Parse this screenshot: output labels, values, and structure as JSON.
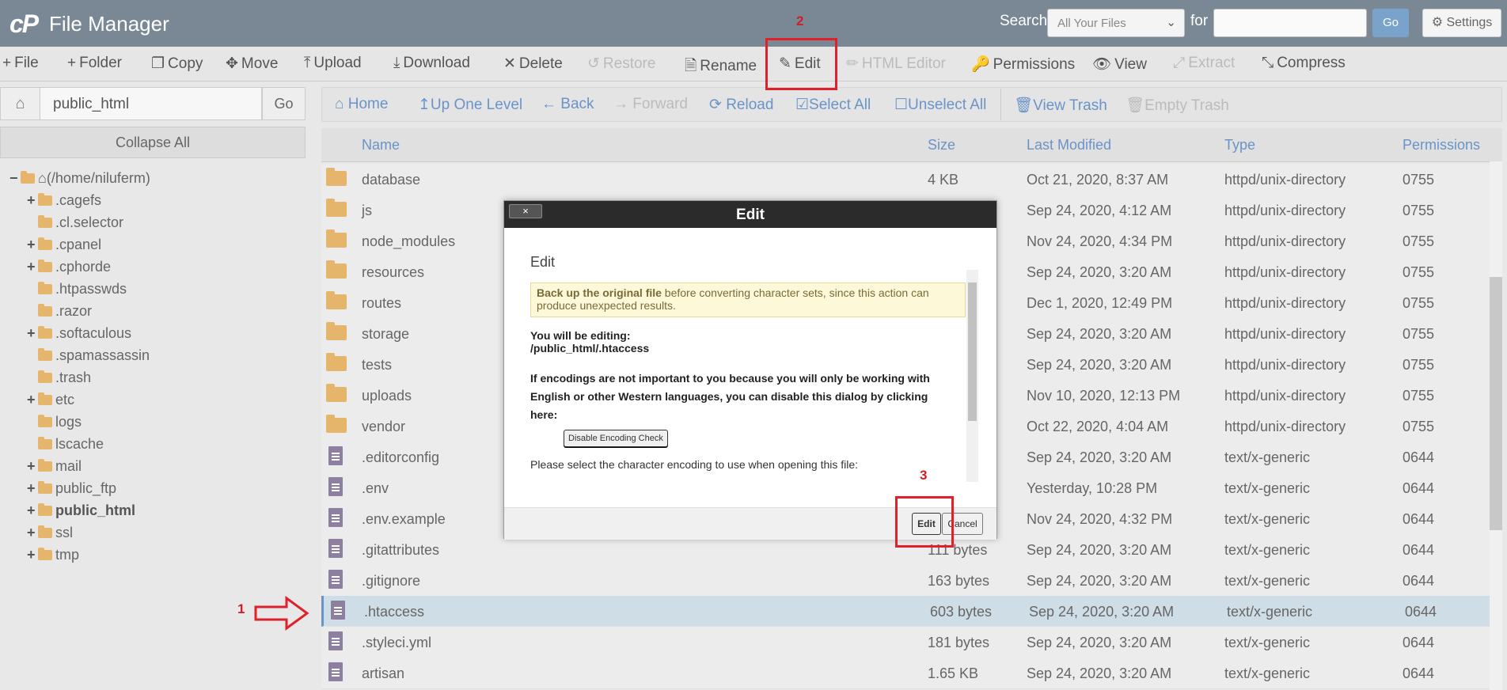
{
  "header": {
    "logo": "cP",
    "title": "File Manager",
    "search_label": "Search",
    "search_scope": "All Your Files",
    "for_label": "for",
    "search_value": "",
    "go_label": "Go",
    "settings_label": "Settings"
  },
  "toolbar": {
    "items": [
      {
        "label": "File",
        "icon": "plus-icon",
        "enabled": true
      },
      {
        "label": "Folder",
        "icon": "plus-icon",
        "enabled": true
      },
      {
        "label": "Copy",
        "icon": "copy-icon",
        "enabled": true
      },
      {
        "label": "Move",
        "icon": "move-icon",
        "enabled": true
      },
      {
        "label": "Upload",
        "icon": "upload-icon",
        "enabled": true
      },
      {
        "label": "Download",
        "icon": "download-icon",
        "enabled": true
      },
      {
        "label": "Delete",
        "icon": "close-icon",
        "enabled": true
      },
      {
        "label": "Restore",
        "icon": "undo-icon",
        "enabled": false
      },
      {
        "label": "Rename",
        "icon": "file-icon",
        "enabled": true
      },
      {
        "label": "Edit",
        "icon": "pencil-icon",
        "enabled": true
      },
      {
        "label": "HTML Editor",
        "icon": "edit-icon",
        "enabled": false
      },
      {
        "label": "Permissions",
        "icon": "key-icon",
        "enabled": true
      },
      {
        "label": "View",
        "icon": "eye-icon",
        "enabled": true
      },
      {
        "label": "Extract",
        "icon": "expand-icon",
        "enabled": false
      },
      {
        "label": "Compress",
        "icon": "compress-icon",
        "enabled": true
      }
    ]
  },
  "pathbar": {
    "path": "public_html",
    "go_label": "Go",
    "collapse_label": "Collapse All"
  },
  "tree": {
    "root": "(/home/niluferm)",
    "items": [
      {
        "label": ".cagefs",
        "expandable": true,
        "bold": false
      },
      {
        "label": ".cl.selector",
        "expandable": false,
        "bold": false
      },
      {
        "label": ".cpanel",
        "expandable": true,
        "bold": false
      },
      {
        "label": ".cphorde",
        "expandable": true,
        "bold": false
      },
      {
        "label": ".htpasswds",
        "expandable": false,
        "bold": false
      },
      {
        "label": ".razor",
        "expandable": false,
        "bold": false
      },
      {
        "label": ".softaculous",
        "expandable": true,
        "bold": false
      },
      {
        "label": ".spamassassin",
        "expandable": false,
        "bold": false
      },
      {
        "label": ".trash",
        "expandable": false,
        "bold": false
      },
      {
        "label": "etc",
        "expandable": true,
        "bold": false
      },
      {
        "label": "logs",
        "expandable": false,
        "bold": false
      },
      {
        "label": "lscache",
        "expandable": false,
        "bold": false
      },
      {
        "label": "mail",
        "expandable": true,
        "bold": false
      },
      {
        "label": "public_ftp",
        "expandable": true,
        "bold": false
      },
      {
        "label": "public_html",
        "expandable": true,
        "bold": true
      },
      {
        "label": "ssl",
        "expandable": true,
        "bold": false
      },
      {
        "label": "tmp",
        "expandable": true,
        "bold": false
      }
    ]
  },
  "nav": {
    "items": [
      {
        "label": "Home",
        "icon": "home-icon",
        "enabled": true
      },
      {
        "label": "Up One Level",
        "icon": "arrow-up-icon",
        "enabled": true
      },
      {
        "label": "Back",
        "icon": "arrow-left-icon",
        "enabled": true
      },
      {
        "label": "Forward",
        "icon": "arrow-right-icon",
        "enabled": false
      },
      {
        "label": "Reload",
        "icon": "reload-icon",
        "enabled": true
      },
      {
        "label": "Select All",
        "icon": "checkbox-checked-icon",
        "enabled": true
      },
      {
        "label": "Unselect All",
        "icon": "checkbox-empty-icon",
        "enabled": true
      },
      {
        "label": "View Trash",
        "icon": "trash-icon",
        "enabled": true
      },
      {
        "label": "Empty Trash",
        "icon": "trash-icon",
        "enabled": false
      }
    ]
  },
  "table": {
    "columns": [
      "Name",
      "Size",
      "Last Modified",
      "Type",
      "Permissions"
    ],
    "rows": [
      {
        "name": "database",
        "kind": "folder",
        "size": "4 KB",
        "modified": "Oct 21, 2020, 8:37 AM",
        "type": "httpd/unix-directory",
        "perms": "0755",
        "selected": false
      },
      {
        "name": "js",
        "kind": "folder",
        "size": "",
        "modified": "Sep 24, 2020, 4:12 AM",
        "type": "httpd/unix-directory",
        "perms": "0755",
        "selected": false
      },
      {
        "name": "node_modules",
        "kind": "folder",
        "size": "",
        "modified": "Nov 24, 2020, 4:34 PM",
        "type": "httpd/unix-directory",
        "perms": "0755",
        "selected": false
      },
      {
        "name": "resources",
        "kind": "folder",
        "size": "",
        "modified": "Sep 24, 2020, 3:20 AM",
        "type": "httpd/unix-directory",
        "perms": "0755",
        "selected": false
      },
      {
        "name": "routes",
        "kind": "folder",
        "size": "",
        "modified": "Dec 1, 2020, 12:49 PM",
        "type": "httpd/unix-directory",
        "perms": "0755",
        "selected": false
      },
      {
        "name": "storage",
        "kind": "folder",
        "size": "",
        "modified": "Sep 24, 2020, 3:20 AM",
        "type": "httpd/unix-directory",
        "perms": "0755",
        "selected": false
      },
      {
        "name": "tests",
        "kind": "folder",
        "size": "",
        "modified": "Sep 24, 2020, 3:20 AM",
        "type": "httpd/unix-directory",
        "perms": "0755",
        "selected": false
      },
      {
        "name": "uploads",
        "kind": "folder",
        "size": "",
        "modified": "Nov 10, 2020, 12:13 PM",
        "type": "httpd/unix-directory",
        "perms": "0755",
        "selected": false
      },
      {
        "name": "vendor",
        "kind": "folder",
        "size": "",
        "modified": "Oct 22, 2020, 4:04 AM",
        "type": "httpd/unix-directory",
        "perms": "0755",
        "selected": false
      },
      {
        "name": ".editorconfig",
        "kind": "file",
        "size": "",
        "modified": "Sep 24, 2020, 3:20 AM",
        "type": "text/x-generic",
        "perms": "0644",
        "selected": false
      },
      {
        "name": ".env",
        "kind": "file",
        "size": "",
        "modified": "Yesterday, 10:28 PM",
        "type": "text/x-generic",
        "perms": "0644",
        "selected": false
      },
      {
        "name": ".env.example",
        "kind": "file",
        "size": "",
        "modified": "Nov 24, 2020, 4:32 PM",
        "type": "text/x-generic",
        "perms": "0644",
        "selected": false
      },
      {
        "name": ".gitattributes",
        "kind": "file",
        "size": "111 bytes",
        "modified": "Sep 24, 2020, 3:20 AM",
        "type": "text/x-generic",
        "perms": "0644",
        "selected": false
      },
      {
        "name": ".gitignore",
        "kind": "file",
        "size": "163 bytes",
        "modified": "Sep 24, 2020, 3:20 AM",
        "type": "text/x-generic",
        "perms": "0644",
        "selected": false
      },
      {
        "name": ".htaccess",
        "kind": "file",
        "size": "603 bytes",
        "modified": "Sep 24, 2020, 3:20 AM",
        "type": "text/x-generic",
        "perms": "0644",
        "selected": true
      },
      {
        "name": ".styleci.yml",
        "kind": "file",
        "size": "181 bytes",
        "modified": "Sep 24, 2020, 3:20 AM",
        "type": "text/x-generic",
        "perms": "0644",
        "selected": false
      },
      {
        "name": "artisan",
        "kind": "file",
        "size": "1.65 KB",
        "modified": "Sep 24, 2020, 3:20 AM",
        "type": "text/x-generic",
        "perms": "0644",
        "selected": false
      }
    ]
  },
  "annotations": {
    "step1": "1",
    "step2": "2",
    "step3": "3",
    "color": "#e0202a"
  },
  "modal": {
    "title": "Edit",
    "close_label": "×",
    "heading": "Edit",
    "warning_bold": "Back up the original file",
    "warning_rest": " before converting character sets, since this action can produce unexpected results.",
    "editing_label": "You will be editing:",
    "editing_path": "/public_html/.htaccess",
    "encoding_text": "If encodings are not important to you because you will only be working with English or other Western languages, you can disable this dialog by clicking here:",
    "disable_button": "Disable Encoding Check",
    "select_text": "Please select the character encoding to use when opening this file:",
    "edit_button": "Edit",
    "cancel_button": "Cancel"
  },
  "colors": {
    "topbar": "#7a8794",
    "link": "#6a94c8",
    "folder": "#e6b56c",
    "file": "#8c7fa0",
    "selected_row": "#cfdde6"
  }
}
